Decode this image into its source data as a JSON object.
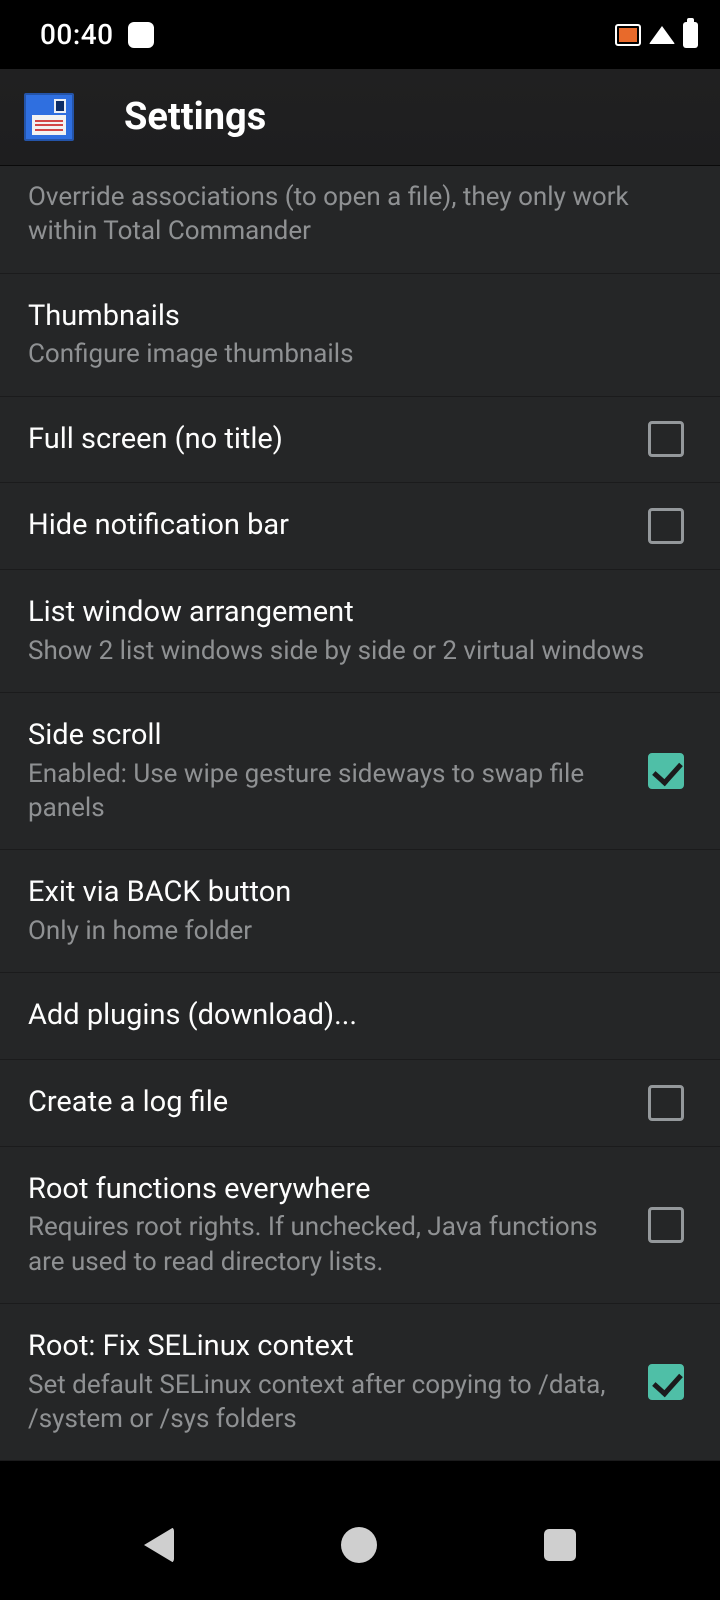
{
  "status": {
    "time": "00:40"
  },
  "header": {
    "title": "Settings"
  },
  "items": [
    {
      "id": "override-associations",
      "title": "",
      "sub": "Override associations (to open a file), they only work within Total Commander",
      "checkbox": null,
      "partial": true
    },
    {
      "id": "thumbnails",
      "title": "Thumbnails",
      "sub": "Configure image thumbnails",
      "checkbox": null
    },
    {
      "id": "full-screen",
      "title": "Full screen (no title)",
      "sub": "",
      "checkbox": false
    },
    {
      "id": "hide-notification-bar",
      "title": "Hide notification bar",
      "sub": "",
      "checkbox": false
    },
    {
      "id": "list-window-arrangement",
      "title": "List window arrangement",
      "sub": "Show 2 list windows side by side or 2 virtual windows",
      "checkbox": null
    },
    {
      "id": "side-scroll",
      "title": "Side scroll",
      "sub": "Enabled: Use wipe gesture sideways to swap file panels",
      "checkbox": true
    },
    {
      "id": "exit-via-back",
      "title": "Exit via BACK button",
      "sub": "Only in home folder",
      "checkbox": null
    },
    {
      "id": "add-plugins",
      "title": "Add plugins (download)...",
      "sub": "",
      "checkbox": null
    },
    {
      "id": "create-log-file",
      "title": "Create a log file",
      "sub": "",
      "checkbox": false
    },
    {
      "id": "root-functions-everywhere",
      "title": "Root functions everywhere",
      "sub": "Requires root rights. If unchecked, Java functions are used to read directory lists.",
      "checkbox": false
    },
    {
      "id": "root-fix-selinux",
      "title": "Root: Fix SELinux context",
      "sub": "Set default SELinux context after copying to /data, /system or /sys folders",
      "checkbox": true
    }
  ]
}
